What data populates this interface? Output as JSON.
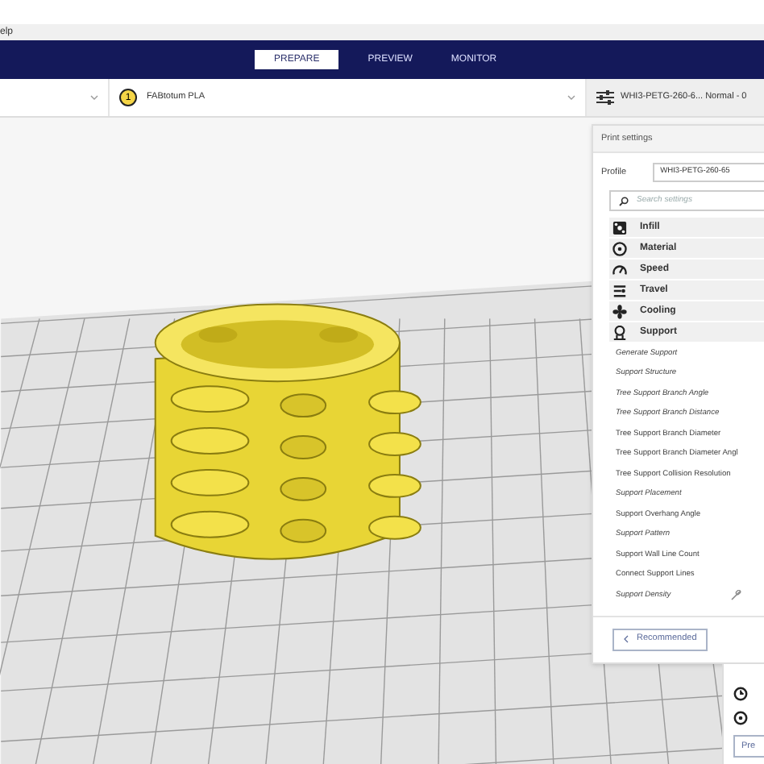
{
  "menu_bar": {
    "items": [
      "elp"
    ]
  },
  "tabs": [
    {
      "label": "PREPARE",
      "selected": true
    },
    {
      "label": "PREVIEW",
      "selected": false
    },
    {
      "label": "MONITOR",
      "selected": false
    }
  ],
  "toolbar": {
    "extruder_number": "1",
    "material": "FABtotum PLA",
    "print_profile": "WHI3-PETG-260-6... Normal - 0"
  },
  "print_settings": {
    "title": "Print settings",
    "profile_label": "Profile",
    "profile_value": "WHI3-PETG-260-65",
    "search": {
      "placeholder": "Search settings"
    },
    "categories": [
      {
        "label": "Infill",
        "kind": "infill"
      },
      {
        "label": "Material",
        "kind": "material"
      },
      {
        "label": "Speed",
        "kind": "speed"
      },
      {
        "label": "Travel",
        "kind": "travel"
      },
      {
        "label": "Cooling",
        "kind": "cooling"
      },
      {
        "label": "Support",
        "kind": "support"
      }
    ],
    "settings": [
      {
        "label": "Generate Support",
        "italic": true
      },
      {
        "label": "Support Structure",
        "italic": true
      },
      {
        "label": "Tree Support Branch Angle",
        "italic": true
      },
      {
        "label": "Tree Support Branch Distance",
        "italic": true
      },
      {
        "label": "Tree Support Branch Diameter",
        "italic": false
      },
      {
        "label": "Tree Support Branch Diameter Angl",
        "italic": false
      },
      {
        "label": "Tree Support Collision Resolution",
        "italic": false
      },
      {
        "label": "Support Placement",
        "italic": true
      },
      {
        "label": "Support Overhang Angle",
        "italic": false
      },
      {
        "label": "Support Pattern",
        "italic": true
      },
      {
        "label": "Support Wall Line Count",
        "italic": false
      },
      {
        "label": "Connect Support Lines",
        "italic": false
      },
      {
        "label": "Support Density",
        "italic": true,
        "linked": true
      }
    ],
    "recommended_button": "Recommended"
  },
  "print_panel": {
    "button": "Pre"
  }
}
